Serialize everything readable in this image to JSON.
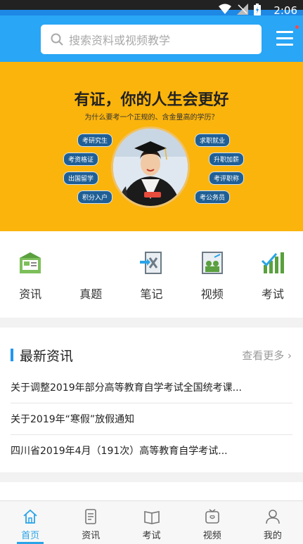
{
  "status_bar": {
    "time": "2:06"
  },
  "search": {
    "placeholder": "搜索资料或视频教学"
  },
  "banner": {
    "headline": "有证，你的人生会更好",
    "subline": "为什么要考一个正规的、含金量高的学历？",
    "tags_left": [
      "考研究生",
      "考资格证",
      "出国留学",
      "积分入户"
    ],
    "tags_right": [
      "求职就业",
      "升职加薪",
      "考评职称",
      "考公务员"
    ]
  },
  "quick_menu": [
    {
      "label": "资讯",
      "icon": "news-icon"
    },
    {
      "label": "真题",
      "icon": "exam-paper-icon"
    },
    {
      "label": "笔记",
      "icon": "notes-icon"
    },
    {
      "label": "视频",
      "icon": "video-icon"
    },
    {
      "label": "考试",
      "icon": "chart-icon"
    }
  ],
  "news": {
    "title": "最新资讯",
    "more": "查看更多 ›",
    "items": [
      "关于调整2019年部分高等教育自学考试全国统考课...",
      "关于2019年“寒假”放假通知",
      "四川省2019年4月（191次）高等教育自学考试..."
    ]
  },
  "tabs": [
    {
      "label": "首页",
      "icon": "home-icon",
      "active": true
    },
    {
      "label": "资讯",
      "icon": "news-tab-icon",
      "active": false
    },
    {
      "label": "考试",
      "icon": "book-icon",
      "active": false
    },
    {
      "label": "视频",
      "icon": "video-tab-icon",
      "active": false
    },
    {
      "label": "我的",
      "icon": "profile-icon",
      "active": false
    }
  ],
  "colors": {
    "primary": "#29a6f5",
    "banner": "#fbb40c",
    "accent": "#2196f3"
  }
}
